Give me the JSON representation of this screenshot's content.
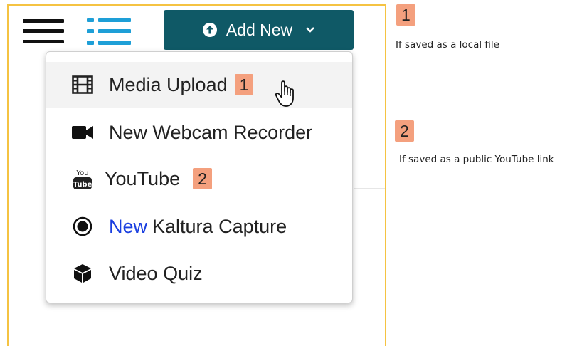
{
  "toolbar": {
    "add_new_label": "Add New"
  },
  "menu": {
    "items": [
      {
        "label": "Media Upload",
        "badge": "1"
      },
      {
        "label": "New Webcam Recorder"
      },
      {
        "label": "YouTube",
        "badge": "2"
      },
      {
        "new_tag": "New",
        "label": "Kaltura Capture"
      },
      {
        "label": "Video Quiz"
      }
    ]
  },
  "annotations": [
    {
      "number": "1",
      "note": "If saved as a local file"
    },
    {
      "number": "2",
      "note": "If saved as a public YouTube link"
    }
  ],
  "icons": {
    "menu": "hamburger-icon",
    "view": "list-view-icon",
    "add": "upload-circle-icon",
    "dropdown": "chevron-down-icon",
    "media": "film-icon",
    "webcam": "video-camera-icon",
    "youtube": "youtube-icon",
    "capture": "record-icon",
    "quiz": "cube-icon",
    "pointer": "hand-pointer-icon"
  },
  "colors": {
    "accent": "#0f5966",
    "list_icon": "#1e9fd7",
    "new_tag": "#1a3fe0",
    "badge": "#f4a07e",
    "frame": "#f5c342"
  }
}
